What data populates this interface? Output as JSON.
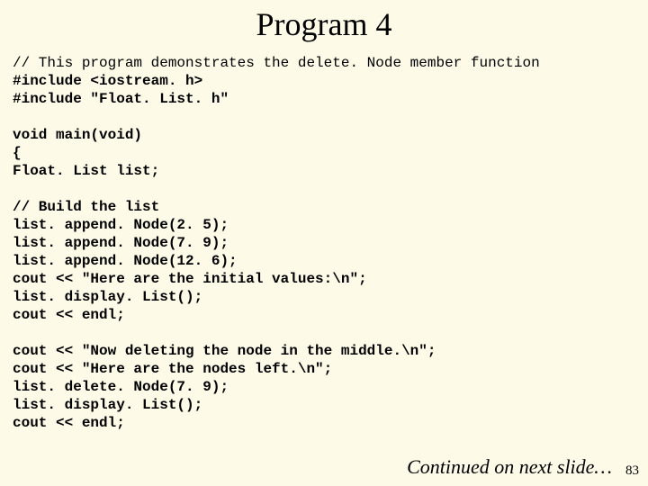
{
  "title": "Program 4",
  "code": {
    "l01": "// This program demonstrates the delete. Node member function",
    "l02": "#include <iostream. h>",
    "l03": "#include \"Float. List. h\"",
    "l04": "",
    "l05": "void main(void)",
    "l06": "{",
    "l07": "Float. List list;",
    "l08": "",
    "l09": "// Build the list",
    "l10": "list. append. Node(2. 5);",
    "l11": "list. append. Node(7. 9);",
    "l12": "list. append. Node(12. 6);",
    "l13": "cout << \"Here are the initial values:\\n\";",
    "l14": "list. display. List();",
    "l15": "cout << endl;",
    "l16": "",
    "l17": "cout << \"Now deleting the node in the middle.\\n\";",
    "l18": "cout << \"Here are the nodes left.\\n\";",
    "l19": "list. delete. Node(7. 9);",
    "l20": "list. display. List();",
    "l21": "cout << endl;"
  },
  "continued": "Continued on next slide…",
  "pagenum": "83"
}
